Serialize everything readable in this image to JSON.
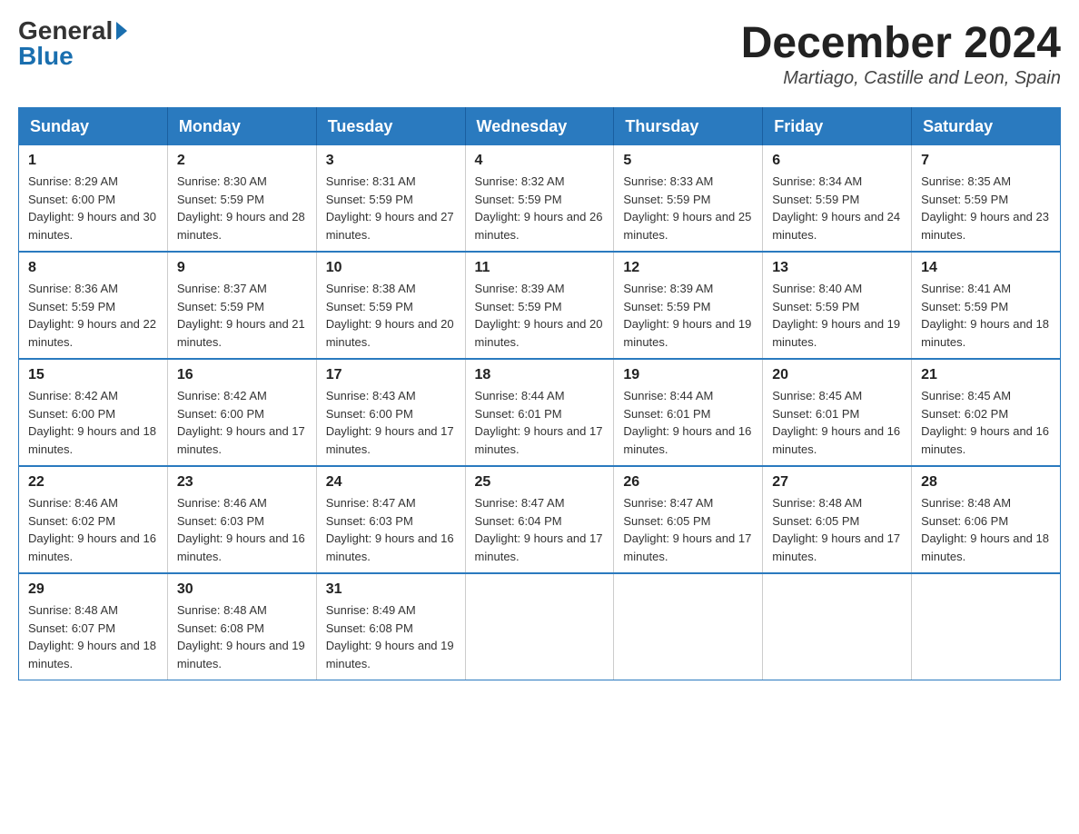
{
  "header": {
    "logo_general": "General",
    "logo_blue": "Blue",
    "month_year": "December 2024",
    "location": "Martiago, Castille and Leon, Spain"
  },
  "days_of_week": [
    "Sunday",
    "Monday",
    "Tuesday",
    "Wednesday",
    "Thursday",
    "Friday",
    "Saturday"
  ],
  "weeks": [
    [
      {
        "day": "1",
        "sunrise": "Sunrise: 8:29 AM",
        "sunset": "Sunset: 6:00 PM",
        "daylight": "Daylight: 9 hours and 30 minutes."
      },
      {
        "day": "2",
        "sunrise": "Sunrise: 8:30 AM",
        "sunset": "Sunset: 5:59 PM",
        "daylight": "Daylight: 9 hours and 28 minutes."
      },
      {
        "day": "3",
        "sunrise": "Sunrise: 8:31 AM",
        "sunset": "Sunset: 5:59 PM",
        "daylight": "Daylight: 9 hours and 27 minutes."
      },
      {
        "day": "4",
        "sunrise": "Sunrise: 8:32 AM",
        "sunset": "Sunset: 5:59 PM",
        "daylight": "Daylight: 9 hours and 26 minutes."
      },
      {
        "day": "5",
        "sunrise": "Sunrise: 8:33 AM",
        "sunset": "Sunset: 5:59 PM",
        "daylight": "Daylight: 9 hours and 25 minutes."
      },
      {
        "day": "6",
        "sunrise": "Sunrise: 8:34 AM",
        "sunset": "Sunset: 5:59 PM",
        "daylight": "Daylight: 9 hours and 24 minutes."
      },
      {
        "day": "7",
        "sunrise": "Sunrise: 8:35 AM",
        "sunset": "Sunset: 5:59 PM",
        "daylight": "Daylight: 9 hours and 23 minutes."
      }
    ],
    [
      {
        "day": "8",
        "sunrise": "Sunrise: 8:36 AM",
        "sunset": "Sunset: 5:59 PM",
        "daylight": "Daylight: 9 hours and 22 minutes."
      },
      {
        "day": "9",
        "sunrise": "Sunrise: 8:37 AM",
        "sunset": "Sunset: 5:59 PM",
        "daylight": "Daylight: 9 hours and 21 minutes."
      },
      {
        "day": "10",
        "sunrise": "Sunrise: 8:38 AM",
        "sunset": "Sunset: 5:59 PM",
        "daylight": "Daylight: 9 hours and 20 minutes."
      },
      {
        "day": "11",
        "sunrise": "Sunrise: 8:39 AM",
        "sunset": "Sunset: 5:59 PM",
        "daylight": "Daylight: 9 hours and 20 minutes."
      },
      {
        "day": "12",
        "sunrise": "Sunrise: 8:39 AM",
        "sunset": "Sunset: 5:59 PM",
        "daylight": "Daylight: 9 hours and 19 minutes."
      },
      {
        "day": "13",
        "sunrise": "Sunrise: 8:40 AM",
        "sunset": "Sunset: 5:59 PM",
        "daylight": "Daylight: 9 hours and 19 minutes."
      },
      {
        "day": "14",
        "sunrise": "Sunrise: 8:41 AM",
        "sunset": "Sunset: 5:59 PM",
        "daylight": "Daylight: 9 hours and 18 minutes."
      }
    ],
    [
      {
        "day": "15",
        "sunrise": "Sunrise: 8:42 AM",
        "sunset": "Sunset: 6:00 PM",
        "daylight": "Daylight: 9 hours and 18 minutes."
      },
      {
        "day": "16",
        "sunrise": "Sunrise: 8:42 AM",
        "sunset": "Sunset: 6:00 PM",
        "daylight": "Daylight: 9 hours and 17 minutes."
      },
      {
        "day": "17",
        "sunrise": "Sunrise: 8:43 AM",
        "sunset": "Sunset: 6:00 PM",
        "daylight": "Daylight: 9 hours and 17 minutes."
      },
      {
        "day": "18",
        "sunrise": "Sunrise: 8:44 AM",
        "sunset": "Sunset: 6:01 PM",
        "daylight": "Daylight: 9 hours and 17 minutes."
      },
      {
        "day": "19",
        "sunrise": "Sunrise: 8:44 AM",
        "sunset": "Sunset: 6:01 PM",
        "daylight": "Daylight: 9 hours and 16 minutes."
      },
      {
        "day": "20",
        "sunrise": "Sunrise: 8:45 AM",
        "sunset": "Sunset: 6:01 PM",
        "daylight": "Daylight: 9 hours and 16 minutes."
      },
      {
        "day": "21",
        "sunrise": "Sunrise: 8:45 AM",
        "sunset": "Sunset: 6:02 PM",
        "daylight": "Daylight: 9 hours and 16 minutes."
      }
    ],
    [
      {
        "day": "22",
        "sunrise": "Sunrise: 8:46 AM",
        "sunset": "Sunset: 6:02 PM",
        "daylight": "Daylight: 9 hours and 16 minutes."
      },
      {
        "day": "23",
        "sunrise": "Sunrise: 8:46 AM",
        "sunset": "Sunset: 6:03 PM",
        "daylight": "Daylight: 9 hours and 16 minutes."
      },
      {
        "day": "24",
        "sunrise": "Sunrise: 8:47 AM",
        "sunset": "Sunset: 6:03 PM",
        "daylight": "Daylight: 9 hours and 16 minutes."
      },
      {
        "day": "25",
        "sunrise": "Sunrise: 8:47 AM",
        "sunset": "Sunset: 6:04 PM",
        "daylight": "Daylight: 9 hours and 17 minutes."
      },
      {
        "day": "26",
        "sunrise": "Sunrise: 8:47 AM",
        "sunset": "Sunset: 6:05 PM",
        "daylight": "Daylight: 9 hours and 17 minutes."
      },
      {
        "day": "27",
        "sunrise": "Sunrise: 8:48 AM",
        "sunset": "Sunset: 6:05 PM",
        "daylight": "Daylight: 9 hours and 17 minutes."
      },
      {
        "day": "28",
        "sunrise": "Sunrise: 8:48 AM",
        "sunset": "Sunset: 6:06 PM",
        "daylight": "Daylight: 9 hours and 18 minutes."
      }
    ],
    [
      {
        "day": "29",
        "sunrise": "Sunrise: 8:48 AM",
        "sunset": "Sunset: 6:07 PM",
        "daylight": "Daylight: 9 hours and 18 minutes."
      },
      {
        "day": "30",
        "sunrise": "Sunrise: 8:48 AM",
        "sunset": "Sunset: 6:08 PM",
        "daylight": "Daylight: 9 hours and 19 minutes."
      },
      {
        "day": "31",
        "sunrise": "Sunrise: 8:49 AM",
        "sunset": "Sunset: 6:08 PM",
        "daylight": "Daylight: 9 hours and 19 minutes."
      },
      null,
      null,
      null,
      null
    ]
  ]
}
